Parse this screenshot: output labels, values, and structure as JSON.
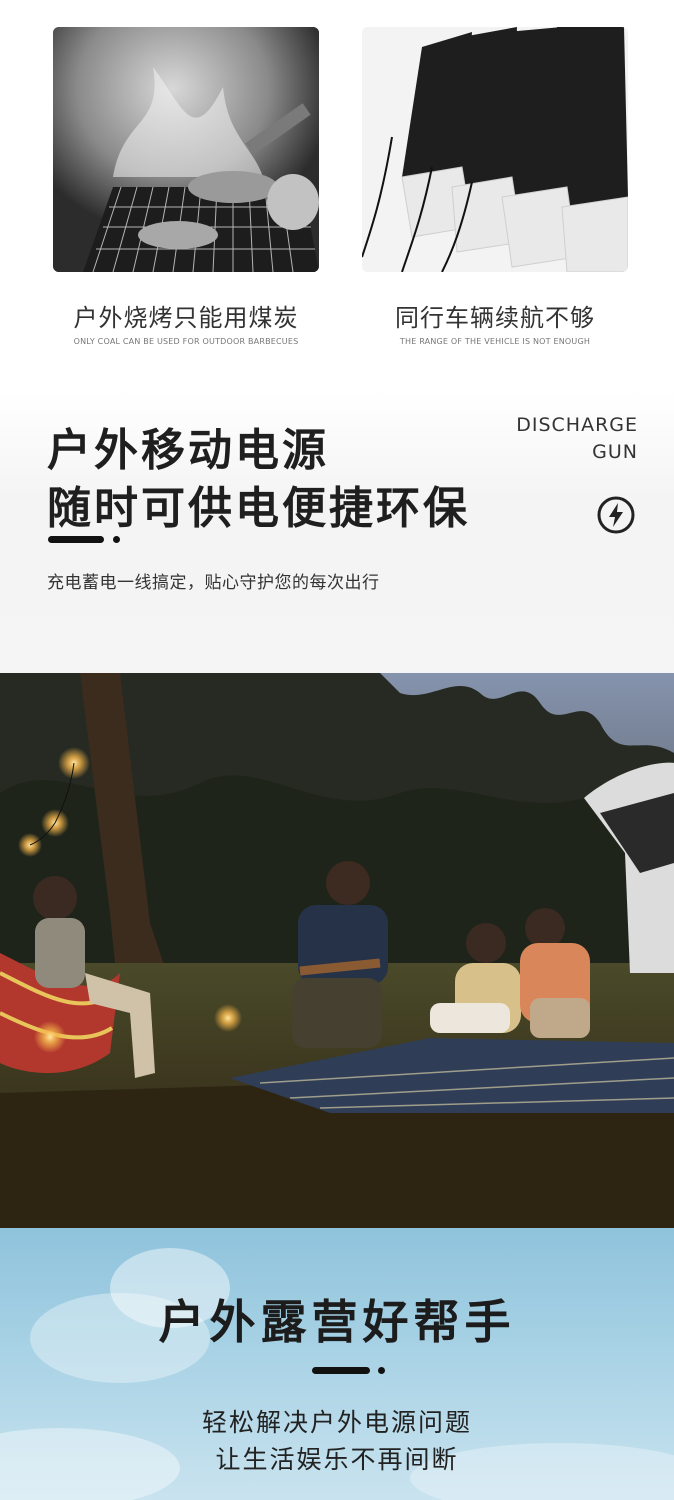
{
  "comparison": [
    {
      "caption_cn": "户外烧烤只能用煤炭",
      "caption_en": "ONLY COAL CAN BE USED FOR OUTDOOR BARBECUES"
    },
    {
      "caption_cn": "同行车辆续航不够",
      "caption_en": "THE RANGE OF THE VEHICLE IS NOT ENOUGH"
    }
  ],
  "headline": {
    "line1": "户外移动电源",
    "line2": "随时可供电便捷环保",
    "tag_line1": "DISCHARGE",
    "tag_line2": "GUN",
    "subtitle": "充电蓄电一线搞定，贴心守护您的每次出行"
  },
  "banner": {
    "title": "户外露营好帮手",
    "line1": "轻松解决户外电源问题",
    "line2": "让生活娱乐不再间断"
  }
}
